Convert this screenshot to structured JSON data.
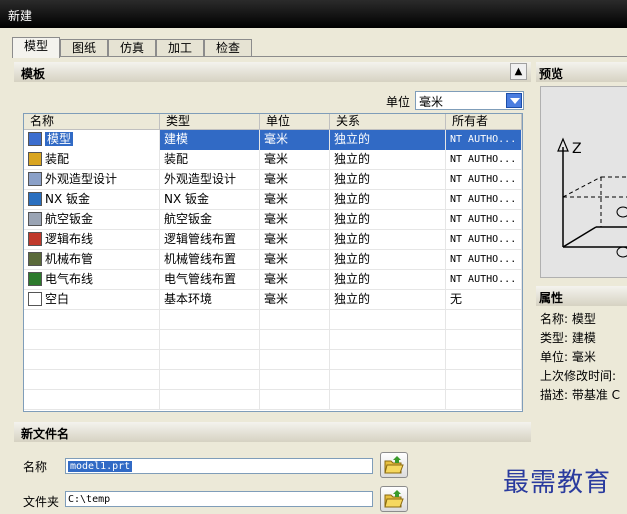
{
  "window": {
    "title": "新建"
  },
  "tabs": [
    {
      "label": "模型",
      "active": true
    },
    {
      "label": "图纸",
      "active": false
    },
    {
      "label": "仿真",
      "active": false
    },
    {
      "label": "加工",
      "active": false
    },
    {
      "label": "检查",
      "active": false
    }
  ],
  "templates": {
    "header": "模板",
    "unit_label": "单位",
    "unit_value": "毫米",
    "columns": [
      "名称",
      "类型",
      "单位",
      "关系",
      "所有者"
    ],
    "rows": [
      {
        "icon": "model-icon",
        "name": "模型",
        "type": "建模",
        "unit": "毫米",
        "relation": "独立的",
        "owner": "NT AUTHO...",
        "selected": true
      },
      {
        "icon": "assembly-icon",
        "name": "装配",
        "type": "装配",
        "unit": "毫米",
        "relation": "独立的",
        "owner": "NT AUTHO...",
        "selected": false
      },
      {
        "icon": "shape-studio-icon",
        "name": "外观造型设计",
        "type": "外观造型设计",
        "unit": "毫米",
        "relation": "独立的",
        "owner": "NT AUTHO...",
        "selected": false
      },
      {
        "icon": "sheet-metal-icon",
        "name": "NX 钣金",
        "type": "NX 钣金",
        "unit": "毫米",
        "relation": "独立的",
        "owner": "NT AUTHO...",
        "selected": false
      },
      {
        "icon": "aero-sheet-metal-icon",
        "name": "航空钣金",
        "type": "航空钣金",
        "unit": "毫米",
        "relation": "独立的",
        "owner": "NT AUTHO...",
        "selected": false
      },
      {
        "icon": "logic-routing-icon",
        "name": "逻辑布线",
        "type": "逻辑管线布置",
        "unit": "毫米",
        "relation": "独立的",
        "owner": "NT AUTHO...",
        "selected": false
      },
      {
        "icon": "mech-routing-icon",
        "name": "机械布管",
        "type": "机械管线布置",
        "unit": "毫米",
        "relation": "独立的",
        "owner": "NT AUTHO...",
        "selected": false
      },
      {
        "icon": "elec-routing-icon",
        "name": "电气布线",
        "type": "电气管线布置",
        "unit": "毫米",
        "relation": "独立的",
        "owner": "NT AUTHO...",
        "selected": false
      },
      {
        "icon": "blank-icon",
        "name": "空白",
        "type": "基本环境",
        "unit": "毫米",
        "relation": "独立的",
        "owner": "无",
        "selected": false
      }
    ]
  },
  "preview": {
    "header": "预览",
    "axis_label": "Z"
  },
  "properties": {
    "header": "属性",
    "lines": [
      "名称: 模型",
      "类型: 建模",
      "单位: 毫米",
      "上次修改时间:",
      "描述: 带基准 C"
    ]
  },
  "new_file": {
    "header": "新文件名",
    "name_label": "名称",
    "name_value": "model1.prt",
    "folder_label": "文件夹",
    "folder_value": "C:\\temp"
  },
  "watermark": "最需教育",
  "colors": {
    "selection": "#316ac5",
    "titlebar": "#000000",
    "dialog_bg": "#ece9d8"
  }
}
